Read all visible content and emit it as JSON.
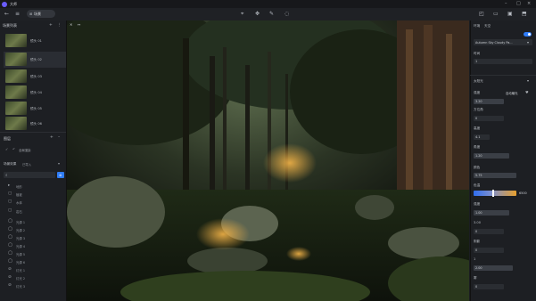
{
  "window": {
    "title": "大师"
  },
  "toolbar": {
    "scene_label": "场景"
  },
  "left": {
    "shots_header": "场景列表",
    "shots": [
      {
        "label": "镜头 01"
      },
      {
        "label": "镜头 02"
      },
      {
        "label": "镜头 03"
      },
      {
        "label": "镜头 04"
      },
      {
        "label": "镜头 05"
      },
      {
        "label": "镜头 06"
      }
    ],
    "layers_header": "图层",
    "render_label": "全局渲染",
    "materials_label": "场景效果",
    "materials_value": "已导入",
    "search_placeholder": "",
    "tree": [
      {
        "label": "地形"
      },
      {
        "label": "植被"
      },
      {
        "label": "水体"
      },
      {
        "label": "岩石"
      },
      {
        "label": "光源 1"
      },
      {
        "label": "光源 2"
      },
      {
        "label": "光源 3"
      },
      {
        "label": "光源 4"
      },
      {
        "label": "光源 5"
      },
      {
        "label": "光源 6"
      },
      {
        "label": "灯光 1"
      },
      {
        "label": "灯光 2"
      },
      {
        "label": "灯光 3"
      }
    ]
  },
  "right": {
    "header": "环境",
    "header2": "天空",
    "preset": "Autumn Sky Cloudy Pa...",
    "time_label": "时间",
    "time_value": "1",
    "section": "太阳光",
    "rows": [
      {
        "label": "强度",
        "value": "自动曝光"
      },
      {
        "label": "",
        "value": "3.20"
      },
      {
        "label": "方位角",
        "value": "0"
      },
      {
        "label": "高度",
        "value": "4.1"
      },
      {
        "label": "角度",
        "value": "1.20"
      },
      {
        "label": "",
        "value": "0.00"
      },
      {
        "label": "颜色",
        "value": ""
      },
      {
        "label": "",
        "value": "5.75"
      },
      {
        "label": "色温",
        "value": "6500"
      },
      {
        "label": "",
        "value": "1.00"
      },
      {
        "label": "强度",
        "value": "3.00"
      },
      {
        "label": "",
        "value": "0"
      },
      {
        "label": "阴影",
        "value": "0"
      },
      {
        "label": "",
        "value": "1"
      },
      {
        "label": "雾",
        "value": "2.00"
      },
      {
        "label": "",
        "value": "0"
      }
    ]
  },
  "colors": {
    "accent": "#2f7cf6",
    "gradient_start": "#2f6df0",
    "gradient_end": "#e7a02e"
  }
}
